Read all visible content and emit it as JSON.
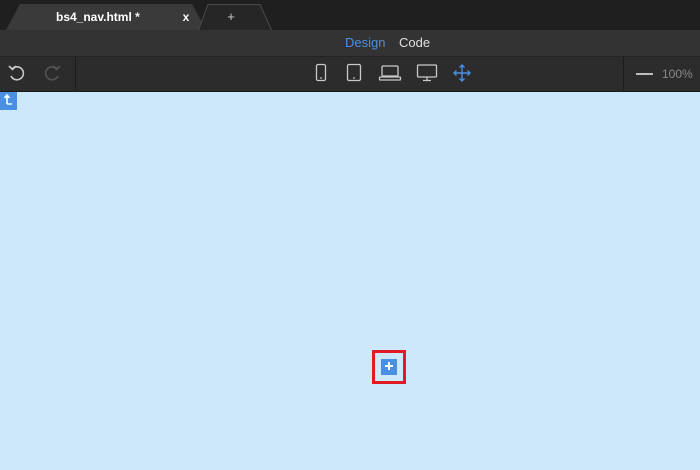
{
  "tabs": {
    "active": {
      "title": "bs4_nav.html *",
      "close_label": "x"
    },
    "new_tab_label": "+"
  },
  "modes": {
    "design_label": "Design",
    "code_label": "Code",
    "active": "Design"
  },
  "toolbar": {
    "icons": [
      "undo-icon",
      "redo-icon",
      "phone-icon",
      "tablet-icon",
      "laptop-icon",
      "desktop-icon",
      "move-icon"
    ],
    "zoom_label": "100%"
  },
  "canvas": {
    "insert_icon": "plus-icon",
    "parent_icon": "select-parent-icon"
  },
  "colors": {
    "accent": "#4a90e2",
    "canvas_bg": "#cce8fa",
    "highlight": "#e01b24",
    "toolbar_bg": "#2c2c2c"
  }
}
